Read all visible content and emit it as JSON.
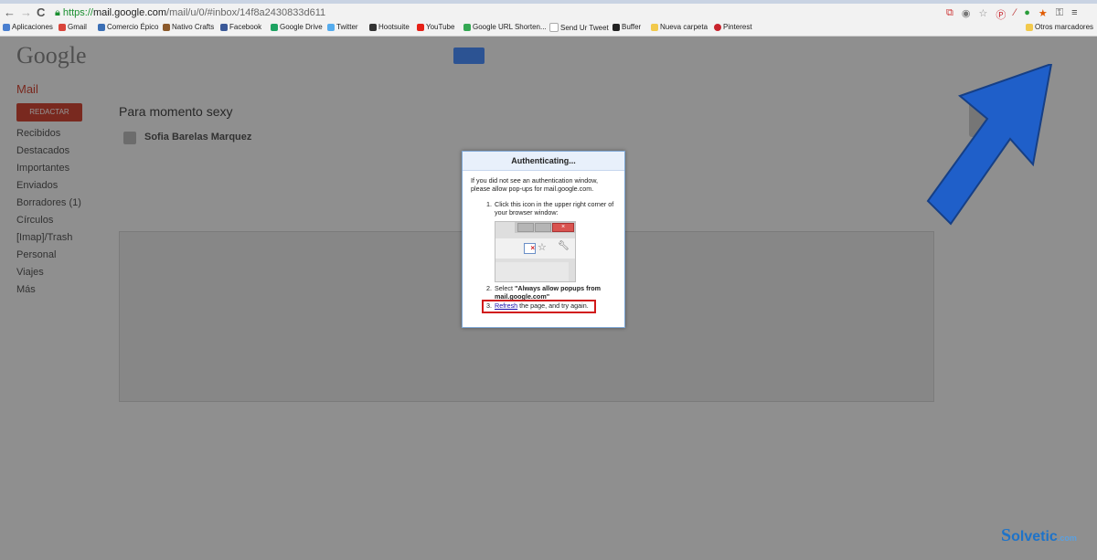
{
  "browser": {
    "url_scheme": "https://",
    "url_host": "mail.google.com",
    "url_path": "/mail/u/0/#inbox/14f8a2430833d611",
    "bookmarks": [
      "Aplicaciones",
      "Gmail",
      "Comercio Épico",
      "Nativo Crafts",
      "Facebook",
      "Google Drive",
      "Twitter",
      "Hootsuite",
      "YouTube",
      "Google URL Shorten...",
      "Send Ur Tweet",
      "Buffer",
      "Nueva carpeta",
      "Pinterest"
    ],
    "other_bookmarks": "Otros marcadores"
  },
  "gmail": {
    "logo": "Google",
    "mail_label": "Mail",
    "compose": "REDACTAR",
    "subject": "Para momento sexy",
    "sender": "Sofia Barelas Marquez",
    "folders": [
      "Recibidos",
      "Destacados",
      "Importantes",
      "Enviados",
      "Borradores (1)",
      "Círculos",
      "[Imap]/Trash",
      "Personal",
      "Viajes",
      "Más"
    ]
  },
  "dialog": {
    "title": "Authenticating...",
    "intro": "If you did not see an authentication window, please allow pop-ups for mail.google.com.",
    "step1_num": "1.",
    "step1": "Click this icon in the upper right corner of your browser window:",
    "step2_num": "2.",
    "step2_pre": "Select ",
    "step2_bold": "\"Always allow popups from mail.google.com\"",
    "step3_num": "3.",
    "step3_link": "Refresh",
    "step3_rest": " the page, and try again."
  },
  "watermark": {
    "brand": "olvetic",
    "suffix": ".com"
  },
  "colors": {
    "arrow": "#1f5fc9",
    "highlight": "#d11a1a",
    "link": "#1a0dab"
  }
}
